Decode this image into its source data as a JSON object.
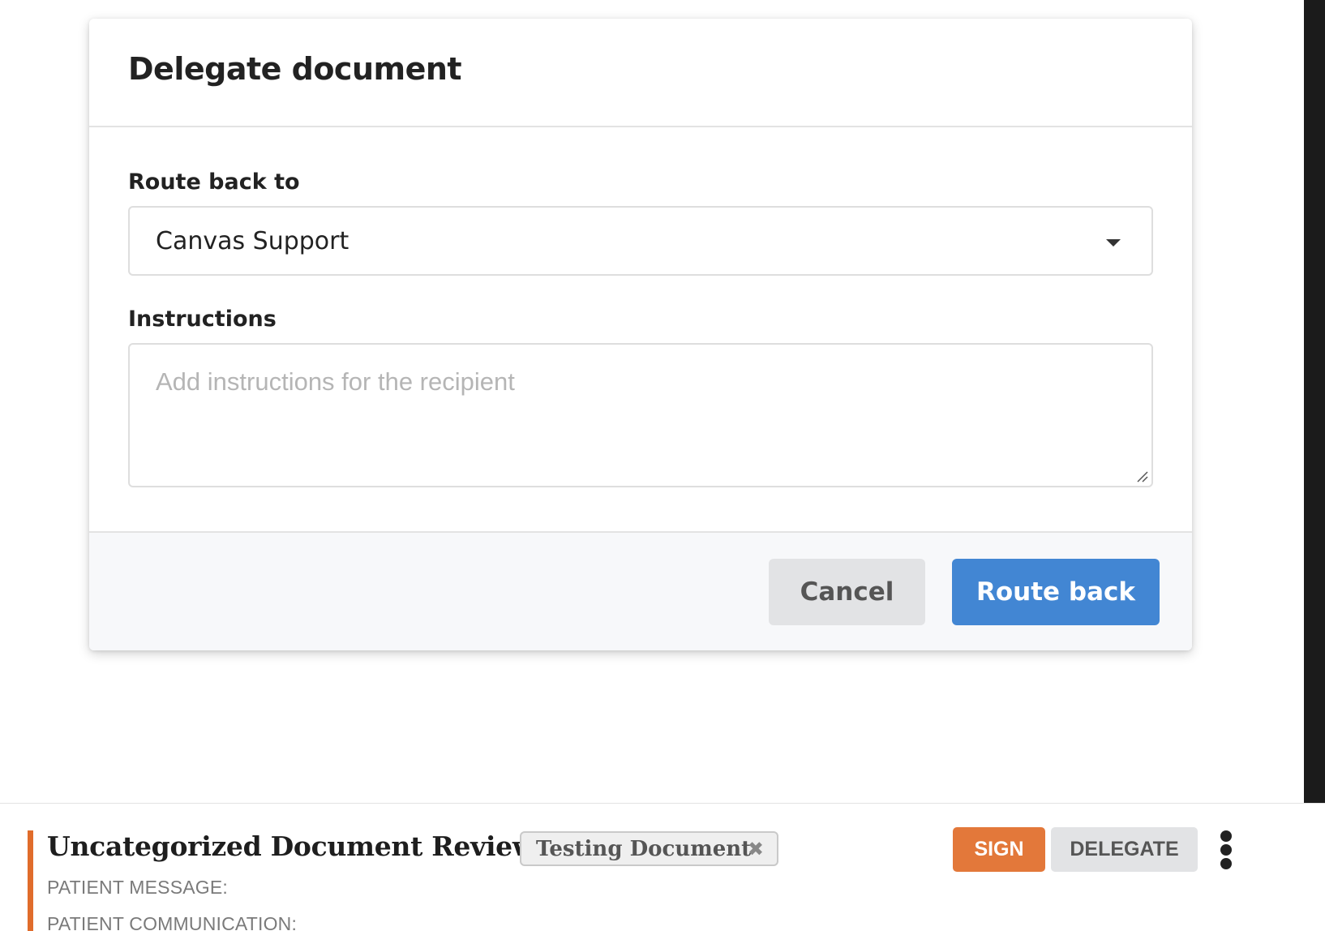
{
  "modal": {
    "title": "Delegate document",
    "route_label": "Route back to",
    "route_selected": "Canvas Support",
    "instructions_label": "Instructions",
    "instructions_placeholder": "Add instructions for the recipient",
    "instructions_value": "",
    "cancel_label": "Cancel",
    "route_back_label": "Route back"
  },
  "card": {
    "title": "Uncategorized Document Review:",
    "tag_label": "Testing Document",
    "tag_remove": "✖",
    "meta": [
      "PATIENT MESSAGE:",
      "PATIENT COMMUNICATION:"
    ],
    "sign_label": "SIGN",
    "delegate_label": "DELEGATE"
  },
  "colors": {
    "primary": "#4286d3",
    "sign": "#e3783a",
    "accent": "#e06c2b"
  },
  "icons": {
    "select_caret": "chevron-down-icon",
    "tag_remove": "close-icon",
    "more": "kebab-menu-icon",
    "textarea_grip": "resize-grip-icon"
  }
}
